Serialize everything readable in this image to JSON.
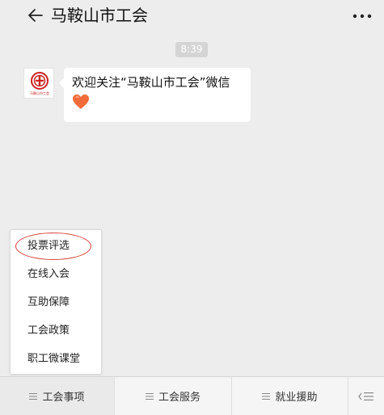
{
  "header": {
    "title": "马鞍山市工会"
  },
  "chat": {
    "timestamp": "8:39",
    "avatar_text": "马鞍山市工会",
    "message_text": "欢迎关注“马鞍山市工会”微信"
  },
  "popup_menu": {
    "items": [
      {
        "label": "投票评选"
      },
      {
        "label": "在线入会"
      },
      {
        "label": "互助保障"
      },
      {
        "label": "工会政策"
      },
      {
        "label": "职工微课堂"
      }
    ]
  },
  "bottom_menu": {
    "tabs": [
      {
        "label": "工会事项"
      },
      {
        "label": "工会服务"
      },
      {
        "label": "就业援助"
      }
    ]
  },
  "colors": {
    "background": "#ededed",
    "bubble": "#ffffff",
    "highlight_ring": "#d9443c",
    "logo_red": "#cc2222",
    "heart": "#f26b3a"
  },
  "icons": {
    "back": "back-arrow-icon",
    "more": "more-dots-icon",
    "heart": "heart-emoji-icon",
    "menu_lines": "menu-lines-icon",
    "keyboard": "keyboard-switch-icon"
  }
}
